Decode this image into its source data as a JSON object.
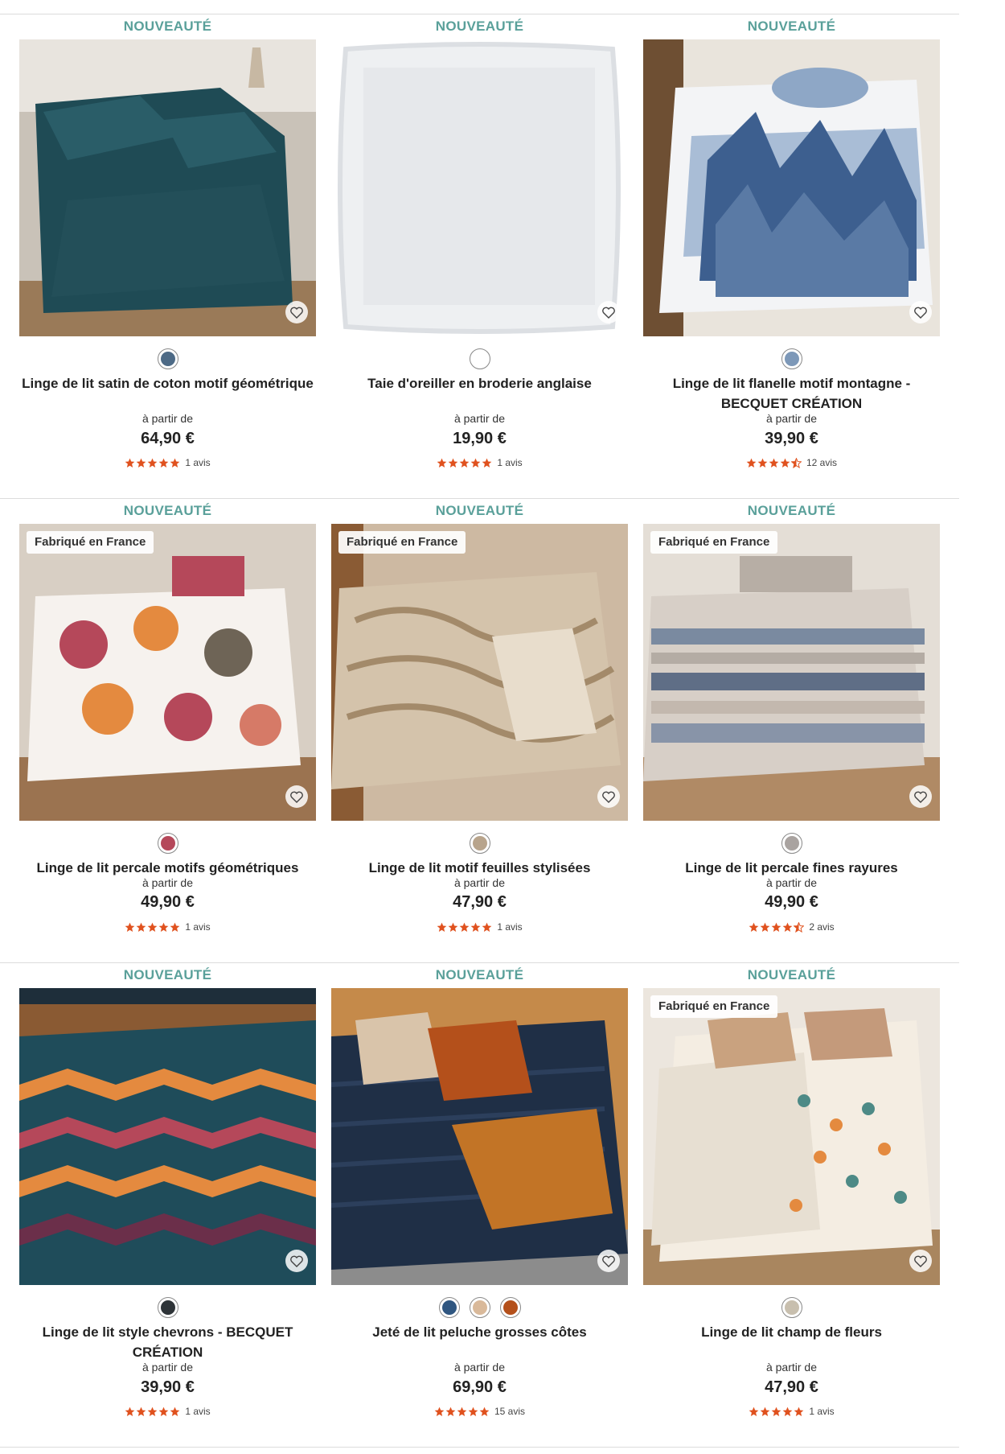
{
  "badge_new": "NOUVEAUTÉ",
  "label_made_in_france": "Fabriqué en France",
  "from_label": "à partir de",
  "colors": {
    "badge_new": "#5aa09a",
    "star": "#e0521f",
    "text": "#222222"
  },
  "products": [
    {
      "title": "Linge de lit satin de coton motif géométrique",
      "price": "64,90 €",
      "rating": 5,
      "reviews": "1 avis",
      "made_in_france": false,
      "swatches": [
        "#4d6a86"
      ],
      "image": "teal-satin-bedding"
    },
    {
      "title": "Taie d'oreiller en broderie anglaise",
      "price": "19,90 €",
      "rating": 5,
      "reviews": "1 avis",
      "made_in_france": false,
      "swatches": [
        "#ffffff"
      ],
      "image": "white-ruffled-pillow"
    },
    {
      "title": "Linge de lit flanelle motif montagne - BECQUET CRÉATION",
      "price": "39,90 €",
      "rating": 4.5,
      "reviews": "12 avis",
      "made_in_france": false,
      "swatches": [
        "#7d98b8"
      ],
      "image": "blue-forest-flannel"
    },
    {
      "title": "Linge de lit percale motifs géométriques",
      "price": "49,90 €",
      "rating": 5,
      "reviews": "1 avis",
      "made_in_france": true,
      "swatches": [
        "#b5485a"
      ],
      "image": "geometric-red-orange"
    },
    {
      "title": "Linge de lit motif feuilles stylisées",
      "price": "47,90 €",
      "rating": 5,
      "reviews": "1 avis",
      "made_in_france": true,
      "swatches": [
        "#b8a48c"
      ],
      "image": "beige-leaves"
    },
    {
      "title": "Linge de lit percale fines rayures",
      "price": "49,90 €",
      "rating": 4.5,
      "reviews": "2 avis",
      "made_in_france": true,
      "swatches": [
        "#a9a3a0"
      ],
      "image": "grey-stripes"
    },
    {
      "title": "Linge de lit style chevrons - BECQUET CRÉATION",
      "price": "39,90 €",
      "rating": 5,
      "reviews": "1 avis",
      "made_in_france": false,
      "swatches": [
        "#2e3438"
      ],
      "image": "chevron-teal"
    },
    {
      "title": "Jeté de lit peluche grosses côtes",
      "price": "69,90 €",
      "rating": 5,
      "reviews": "15 avis",
      "made_in_france": false,
      "swatches": [
        "#2f5680",
        "#d9b99a",
        "#b4501b"
      ],
      "image": "navy-plush-throw"
    },
    {
      "title": "Linge de lit champ de fleurs",
      "price": "47,90 €",
      "rating": 5,
      "reviews": "1 avis",
      "made_in_france": true,
      "swatches": [
        "#c8bfae"
      ],
      "image": "floral-field"
    }
  ]
}
